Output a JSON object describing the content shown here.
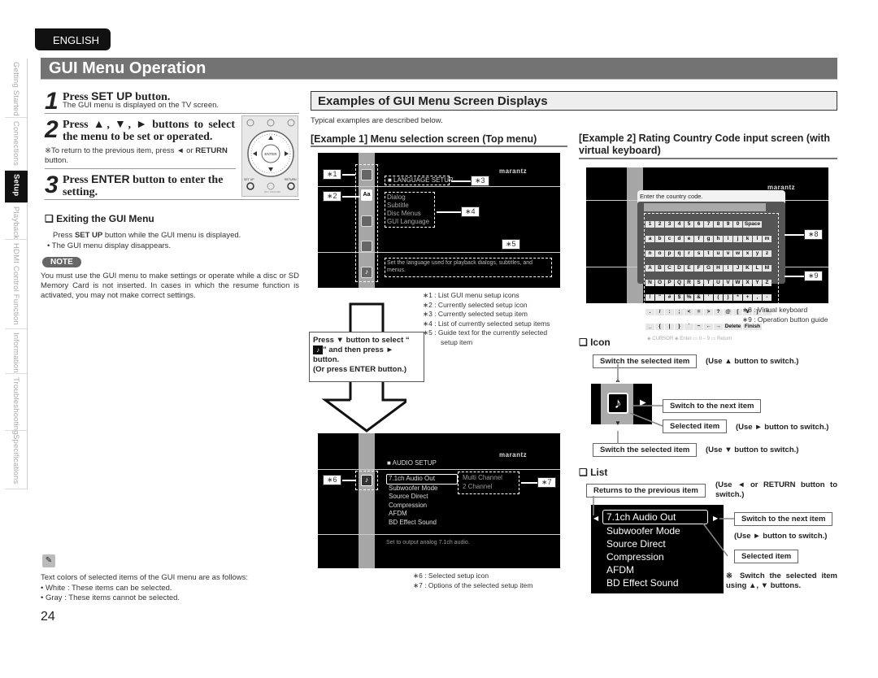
{
  "language_tab": "ENGLISH",
  "side_tabs": [
    {
      "label": "Getting Started",
      "active": false
    },
    {
      "label": "Connections",
      "active": false
    },
    {
      "label": "Setup",
      "active": true
    },
    {
      "label": "Playback",
      "active": false
    },
    {
      "label": "HDMI Control Function",
      "active": false
    },
    {
      "label": "Information",
      "active": false
    },
    {
      "label": "Troubleshooting",
      "active": false
    },
    {
      "label": "Specifications",
      "active": false
    }
  ],
  "page_title": "GUI Menu Operation",
  "steps": [
    {
      "num": "1",
      "title_pre": "Press ",
      "title_key": "SET UP",
      "title_post": " button.",
      "desc": "The GUI menu is displayed on the TV screen."
    },
    {
      "num": "2",
      "title": "Press ▲, ▼, ► buttons to select the menu to be set or operated.",
      "note_pre": "※To return to the previous item, press ◄ or ",
      "note_key": "RETURN",
      "note_post": " button."
    },
    {
      "num": "3",
      "title_pre": "Press ",
      "title_key": "ENTER",
      "title_post": " button to enter the setting."
    }
  ],
  "remote": {
    "enter": "ENTER",
    "setup": "SET UP",
    "return": "RETURN",
    "ret_resume": "RET. RESUME"
  },
  "exiting": {
    "heading": "❏ Exiting the GUI Menu",
    "line1_pre": "Press ",
    "line1_key": "SET UP",
    "line1_post": " button while the GUI menu is displayed.",
    "bullet": "• The GUI menu display disappears."
  },
  "note": {
    "badge": "NOTE",
    "text": "You must use the GUI menu to make settings or operate while a disc or SD Memory Card is not inserted. In cases in which the resume function is activated, you may not make correct settings."
  },
  "memo": {
    "icon": "pencil-icon",
    "intro": "Text colors of selected items of the GUI menu are as follows:",
    "items": [
      "• White : These items can be selected.",
      "• Gray : These items cannot be selected."
    ]
  },
  "page_number": "24",
  "examples": {
    "heading": "Examples of GUI Menu Screen Displays",
    "intro": "Typical examples are described below.",
    "ex1": {
      "heading": "[Example 1] Menu selection screen (Top menu)",
      "brand": "marantz",
      "current_item": "■ LANGUAGE SETUP",
      "items": [
        "Dialog",
        "Subtitle",
        "Disc Menus",
        "GUI Language"
      ],
      "guide": "Set the language used for playback dialogs, subtitles, and menus.",
      "tags": [
        "∗1",
        "∗2",
        "∗3",
        "∗4",
        "∗5"
      ],
      "legend": [
        "∗1 : List GUI menu setup icons",
        "∗2 : Currently selected setup icon",
        "∗3 : Currently selected setup item",
        "∗4 : List of currently selected setup items",
        "∗5 : Guide text for the currently selected",
        "setup item"
      ],
      "instruction": {
        "line1": "Press ▼ button to select “",
        "line2": "” and then press ►",
        "line3": "button.",
        "line4": "(Or press ENTER button.)"
      },
      "audio_screen": {
        "brand": "marantz",
        "title": "■ AUDIO SETUP",
        "items": [
          "7.1ch Audio Out",
          "Subwoofer Mode",
          "Source Direct",
          "Compression",
          "AFDM",
          "BD Effect Sound"
        ],
        "options": [
          "Multi Channel",
          "2 Channel"
        ],
        "guide": "Set to output analog 7.1ch audio.",
        "tags": [
          "∗6",
          "∗7"
        ]
      },
      "legend2": [
        "∗6 : Selected setup icon",
        "∗7 : Options of the selected setup item"
      ]
    },
    "ex2": {
      "heading": "[Example 2] Rating Country Code input screen (with virtual keyboard)",
      "brand": "marantz",
      "prompt": "Enter the country code.",
      "keyboard_rows": [
        [
          "1",
          "2",
          "3",
          "4",
          "5",
          "6",
          "7",
          "8",
          "9",
          "0",
          "Space"
        ],
        [
          "a",
          "b",
          "c",
          "d",
          "e",
          "f",
          "g",
          "h",
          "i",
          "j",
          "k",
          "l",
          "m"
        ],
        [
          "n",
          "o",
          "p",
          "q",
          "r",
          "s",
          "t",
          "u",
          "v",
          "w",
          "x",
          "y",
          "z"
        ],
        [
          "A",
          "B",
          "C",
          "D",
          "E",
          "F",
          "G",
          "H",
          "I",
          "J",
          "K",
          "L",
          "M"
        ],
        [
          "N",
          "O",
          "P",
          "Q",
          "R",
          "S",
          "T",
          "U",
          "V",
          "W",
          "X",
          "Y",
          "Z"
        ],
        [
          "!",
          "\"",
          "#",
          "$",
          "%",
          "&",
          "'",
          "(",
          ")",
          "*",
          "+",
          ",",
          "-"
        ],
        [
          ".",
          "/",
          ":",
          ";",
          "<",
          "=",
          ">",
          "?",
          "@",
          "[",
          "¥",
          "]",
          "^"
        ],
        [
          "_",
          "{",
          "|",
          "}",
          "`",
          "~",
          "←",
          "→",
          "Delete",
          "Finish"
        ]
      ],
      "guide_bar": [
        "CURSOR",
        "Enter",
        "0 – 9",
        "Return"
      ],
      "tags": [
        "∗8",
        "∗9"
      ],
      "legend": [
        "∗8 : Virtual keyboard",
        "∗9 : Operation button guide"
      ]
    },
    "icon_section": {
      "heading": "❏ Icon",
      "switch_up": "Switch the selected item",
      "switch_up_note": "(Use ▲ button to switch.)",
      "next": "Switch to the next item",
      "selected": "Selected item",
      "selected_note": "(Use ► button to switch.)",
      "switch_down": "Switch the selected item",
      "switch_down_note": "(Use ▼ button to switch.)"
    },
    "list_section": {
      "heading": "❏ List",
      "prev": "Returns to the previous item",
      "prev_note": "(Use ◄ or RETURN button to switch.)",
      "items": [
        "7.1ch Audio Out",
        "Subwoofer Mode",
        "Source Direct",
        "Compression",
        "AFDM",
        "BD Effect Sound"
      ],
      "next": "Switch to the next item",
      "next_note": "(Use ► button to switch.)",
      "selected": "Selected item",
      "footnote": "※ Switch the selected item using ▲, ▼ buttons."
    }
  }
}
